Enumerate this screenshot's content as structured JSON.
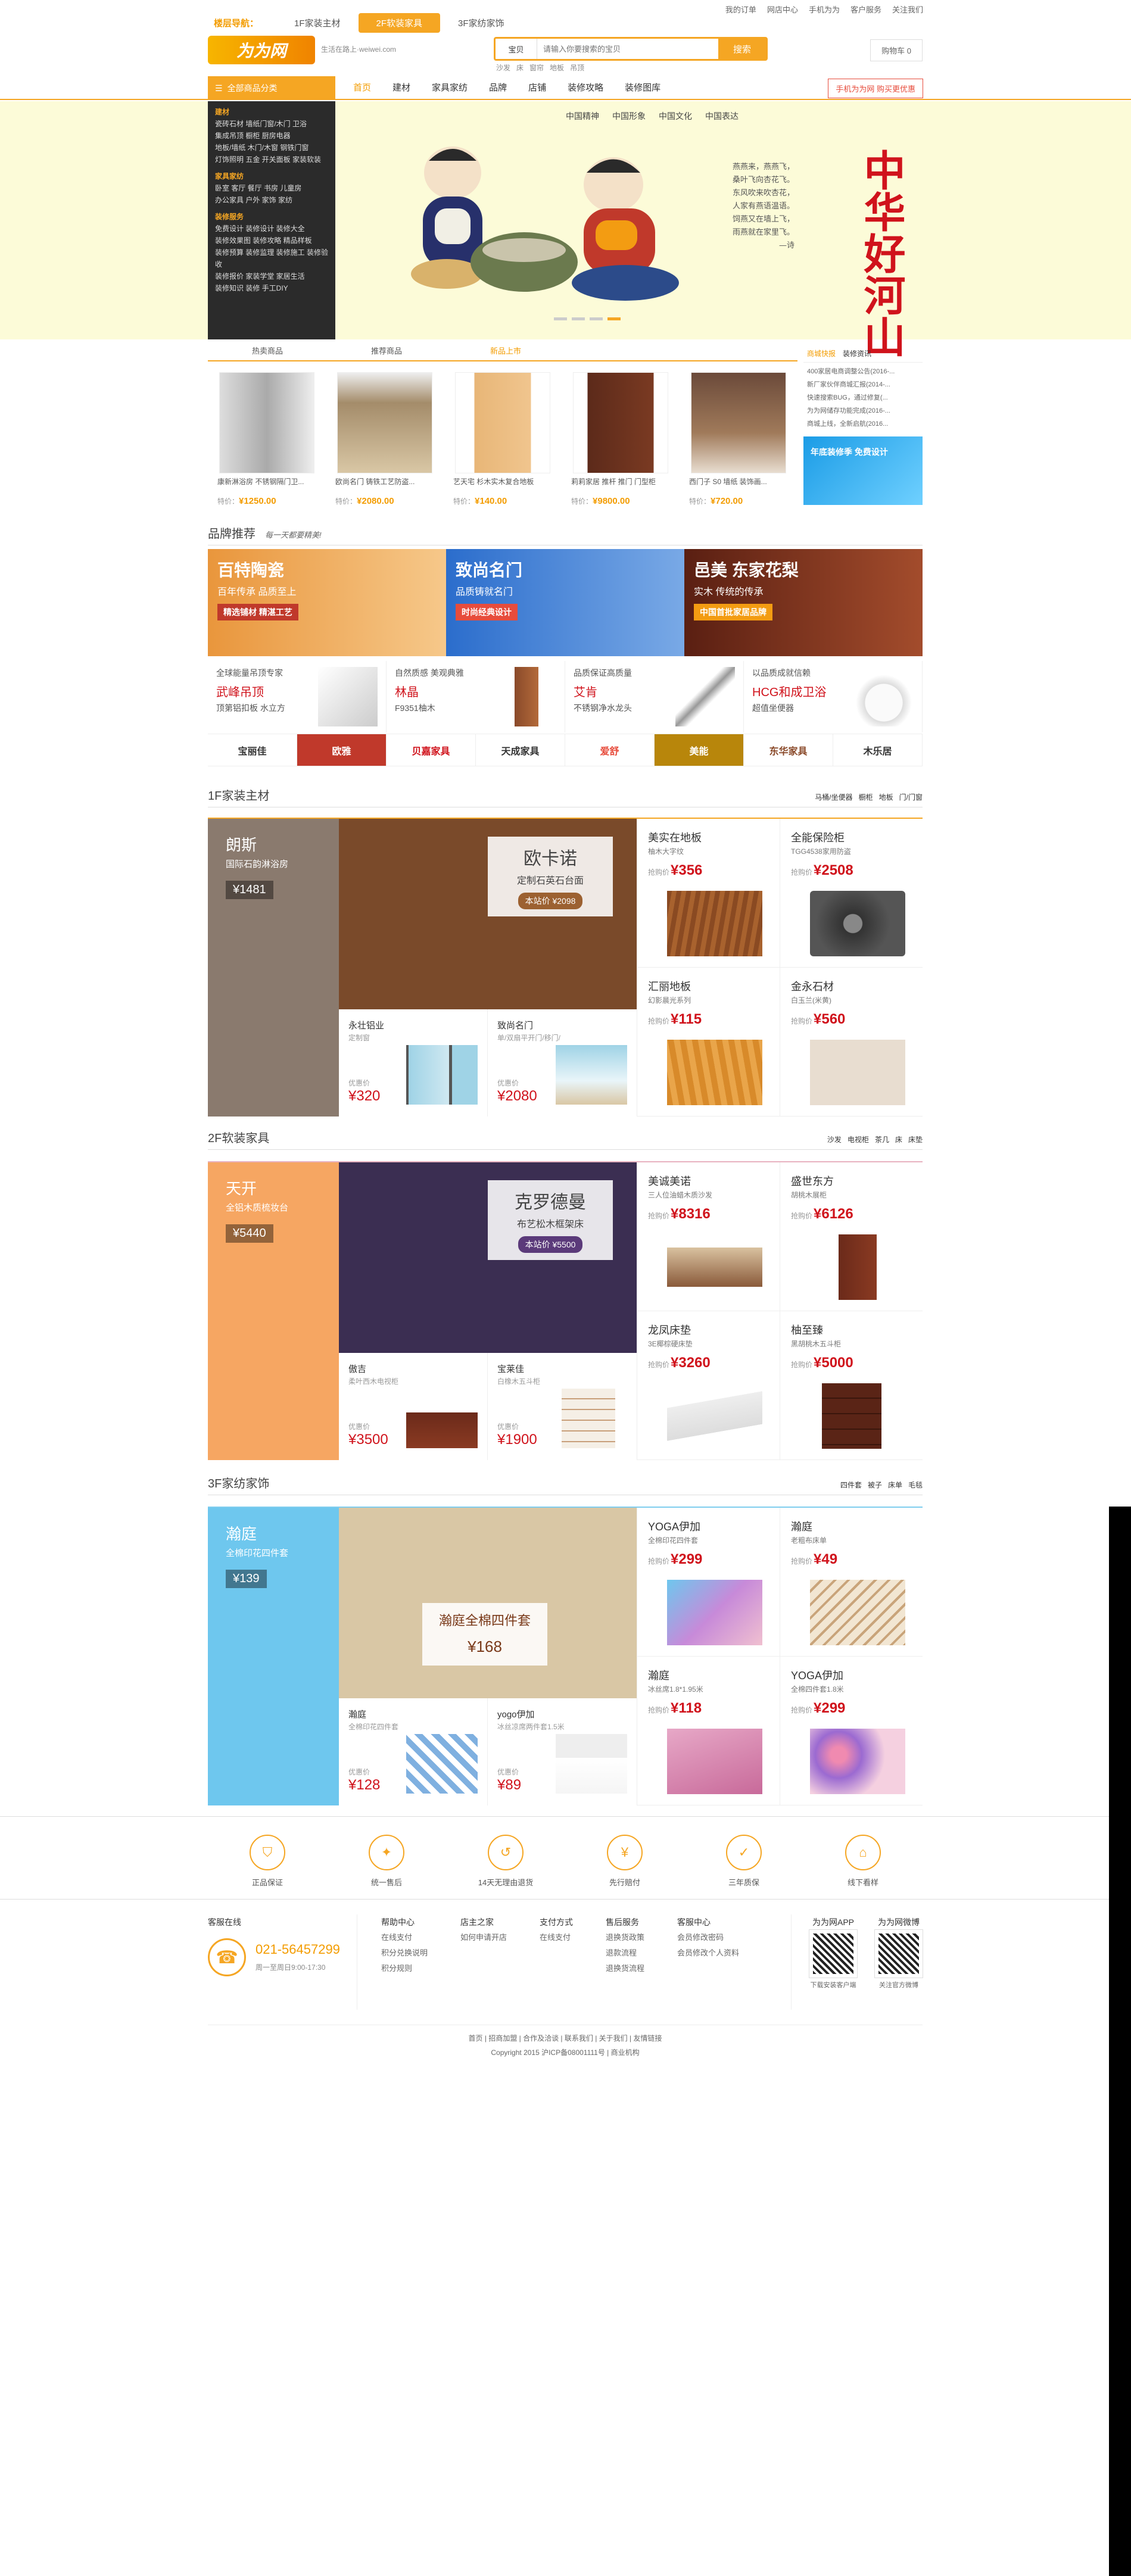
{
  "topbar": {
    "floors": [
      "楼层导航：",
      "1F家装主材",
      "2F软装家具",
      "3F家纺家饰"
    ],
    "links": [
      "我的订单",
      "网店中心",
      "手机为为",
      "客户服务",
      "关注我们"
    ]
  },
  "header": {
    "logo": "为为网",
    "slogan": "生活在路上·weiwei.com",
    "search_select": "宝贝",
    "search_placeholder": "请输入你要搜索的宝贝",
    "search_button": "搜索",
    "hotwords": [
      "沙发",
      "床",
      "窗帘",
      "地板",
      "吊顶"
    ],
    "cart": "购物车 0"
  },
  "nav": {
    "category_button": "全部商品分类",
    "links": [
      "首页",
      "建材",
      "家具家纺",
      "品牌",
      "店铺",
      "装修攻略",
      "装修图库"
    ],
    "app_button": "手机为为网 购买更优惠"
  },
  "category_panel": [
    {
      "title": "建材",
      "lines": [
        "瓷砖石材 墙纸门窗/木门 卫浴",
        "集成吊顶 橱柜 厨房电器",
        "地板/墙纸 木门/木窗 钢铁门窗",
        "灯饰照明 五金 开关面板 家装软装"
      ]
    },
    {
      "title": "家具家纺",
      "lines": [
        "卧室 客厅 餐厅 书房 儿童房",
        "办公家具 户外 家饰 家纺"
      ]
    },
    {
      "title": "装修服务",
      "lines": [
        "免费设计 装修设计 装修大全",
        "装修效果图 装修攻略 精品样板",
        "装修预算 装修监理 装修施工 装修验收",
        "装修报价 家装学堂 家居生活",
        "装修知识 装修 手工DIY"
      ]
    }
  ],
  "banner": {
    "tags": [
      "中国精神",
      "中国形象",
      "中国文化",
      "中国表达"
    ],
    "poem": [
      "燕燕来，燕燕飞，",
      "桑叶飞向杏花飞。",
      "东风吹来吹杏花，",
      "人家有燕语温语。",
      "饲燕又在墙上飞，",
      "雨燕就在家里飞。"
    ],
    "poem_sign": "—诗",
    "callig": "中华好河山"
  },
  "product_tabs": [
    "热卖商品",
    "推荐商品",
    "新品上市"
  ],
  "products": [
    {
      "title": "康新淋浴房 不锈钢隔门卫...",
      "price_label": "特价：",
      "price": "¥1250.00"
    },
    {
      "title": "欧尚名门 铸铁工艺防盗...",
      "price_label": "特价：",
      "price": "¥2080.00"
    },
    {
      "title": "艺天宅 杉木实木复合地板",
      "price_label": "特价：",
      "price": "¥140.00"
    },
    {
      "title": "莉莉家居 推杆 推门 门型柜",
      "price_label": "特价：",
      "price": "¥9800.00"
    },
    {
      "title": "西门子 S0 墙纸 装饰画...",
      "price_label": "特价：",
      "price": "¥720.00"
    }
  ],
  "news": {
    "tabs": [
      "商城快报",
      "装修资讯"
    ],
    "items": [
      "400家居电商调整公告(2016-...",
      "新厂家伙伴商城汇报(2014-...",
      "快速搜索BUG，通过修复(...",
      "为为网储存功能完成(2016-...",
      "商城上线，全新启航(2016..."
    ],
    "ad": "年底装修季 免费设计"
  },
  "brand_section": {
    "title": "品牌推荐",
    "sub": "每一天都要精美!"
  },
  "brand_banners": [
    {
      "t": "百特陶瓷",
      "s": "百年传承 品质至上",
      "tag": "精选铺材 精湛工艺",
      "bg": "linear-gradient(90deg,#e9963c,#f6c88a)"
    },
    {
      "t": "致尚名门",
      "s": "品质铸就名门",
      "tag": "时尚经典设计",
      "bg": "linear-gradient(90deg,#2b6dcc,#79a9e6)"
    },
    {
      "t": "邑美 东家花梨",
      "s": "实木 传统的传承",
      "tag": "中国首批家居品牌",
      "bg": "linear-gradient(90deg,#5a1f12,#a34c2c)"
    }
  ],
  "brand_cells": [
    {
      "c1": "全球能量吊顶专家",
      "c2": "武峰吊顶",
      "c3": "顶第铝扣板 水立方"
    },
    {
      "c1": "自然质感 美观典雅",
      "c2": "林晶",
      "c3": "F9351柚木"
    },
    {
      "c1": "品质保证高质量",
      "c2": "艾肯",
      "c3": "不锈钢净水龙头"
    },
    {
      "c1": "以品质成就信赖",
      "c2": "HCG和成卫浴",
      "c3": "超值坐便器"
    }
  ],
  "brand_logos": [
    "宝丽佳",
    "欧雅",
    "贝嘉家具",
    "天成家具",
    "爱舒",
    "美能",
    "东华家具",
    "木乐居"
  ],
  "floor1": {
    "title": "1F家装主材",
    "links": [
      "马桶/坐便器",
      "橱柜",
      "地板",
      "门/门窗"
    ],
    "left": {
      "a": "朗斯",
      "b": "国际石韵淋浴房",
      "c": "¥1481",
      "bg": "#8a7a6e"
    },
    "mid": {
      "m1": "欧卡诺",
      "m2": "定制石英石台面",
      "m3": "本站价 ¥2098",
      "bg": "#7a4a2a"
    },
    "bl": {
      "n": "永壮铝业",
      "s": "定制窗",
      "pl": "¥320",
      "pll": "优惠价"
    },
    "br": {
      "n": "致尚名门",
      "s": "单/双扇平开门/移门/",
      "pl": "¥2080",
      "pll": "优惠价"
    },
    "cells": [
      {
        "n": "美实在地板",
        "d": "柚木大字纹",
        "p": "¥356"
      },
      {
        "n": "全能保险柜",
        "d": "TGG4538家用防盗",
        "p": "¥2508"
      },
      {
        "n": "汇丽地板",
        "d": "幻影晨光系列",
        "p": "¥115"
      },
      {
        "n": "金永石材",
        "d": "白玉兰(米黄)",
        "p": "¥560"
      }
    ]
  },
  "floor2": {
    "title": "2F软装家具",
    "links": [
      "沙发",
      "电视柜",
      "茶几",
      "床",
      "床垫"
    ],
    "left": {
      "a": "天开",
      "b": "全铝木质梳妆台",
      "c": "¥5440",
      "bg": "#f6a662"
    },
    "mid": {
      "m1": "克罗德曼",
      "m2": "布艺松木框架床",
      "m3": "本站价 ¥5500",
      "bg": "#3b2e52"
    },
    "bl": {
      "n": "傲吉",
      "s": "柔叶西木电视柜",
      "pl": "¥3500",
      "pll": "优惠价"
    },
    "br": {
      "n": "宝莱佳",
      "s": "白橡木五斗柜",
      "pl": "¥1900",
      "pll": "优惠价"
    },
    "cells": [
      {
        "n": "美诚美诺",
        "d": "三人位油蜡木质沙发",
        "p": "¥8316"
      },
      {
        "n": "盛世东方",
        "d": "胡桃木展柜",
        "p": "¥6126"
      },
      {
        "n": "龙凤床垫",
        "d": "3E椰棕硬床垫",
        "p": "¥3260"
      },
      {
        "n": "柚至臻",
        "d": "黑胡桃木五斗柜",
        "p": "¥5000"
      }
    ]
  },
  "floor3": {
    "title": "3F家纺家饰",
    "links": [
      "四件套",
      "被子",
      "床单",
      "毛毯"
    ],
    "left": {
      "a": "瀚庭",
      "b": "全棉印花四件套",
      "c": "¥139",
      "bg": "#6ec7ee"
    },
    "mid": {
      "m1": "瀚庭全棉四件套",
      "m2": "",
      "m3": "¥168",
      "bg": "#d9c7a5"
    },
    "bl": {
      "n": "瀚庭",
      "s": "全棉印花四件套",
      "pl": "¥128",
      "pll": "优惠价"
    },
    "br": {
      "n": "yogo伊加",
      "s": "冰丝凉席两件套1.5米",
      "pl": "¥89",
      "pll": "优惠价"
    },
    "cells": [
      {
        "n": "YOGA伊加",
        "d": "全棉印花四件套",
        "p": "¥299"
      },
      {
        "n": "瀚庭",
        "d": "老粗布床单",
        "p": "¥49"
      },
      {
        "n": "瀚庭",
        "d": "冰丝席1.8*1.95米",
        "p": "¥118"
      },
      {
        "n": "YOGA伊加",
        "d": "全棉四件套1.8米",
        "p": "¥299"
      }
    ]
  },
  "services": [
    "正品保证",
    "统一售后",
    "14天无理由退货",
    "先行赔付",
    "三年质保",
    "线下看样"
  ],
  "footer": {
    "hotline_title": "客服在线",
    "hotline": "021-56457299",
    "hours": "周一至周日9:00-17:30",
    "cols": [
      {
        "h": "帮助中心",
        "items": [
          "在线支付",
          "积分兑换说明",
          "积分规则"
        ]
      },
      {
        "h": "店主之家",
        "items": [
          "如何申请开店"
        ]
      },
      {
        "h": "支付方式",
        "items": [
          "在线支付"
        ]
      },
      {
        "h": "售后服务",
        "items": [
          "退换货政策",
          "退款流程",
          "退换货流程"
        ]
      },
      {
        "h": "客服中心",
        "items": [
          "会员修改密码",
          "会员修改个人资料"
        ]
      }
    ],
    "qr": [
      {
        "h": "为为网APP",
        "cap": "下载安装客户端"
      },
      {
        "h": "为为网微博",
        "cap": "关注官方微博"
      }
    ]
  },
  "copyright": {
    "links": "首页 | 招商加盟 | 合作及洽谈 | 联系我们 | 关于我们 | 友情链接",
    "text": "Copyright 2015 沪ICP备08001111号 | 商业机构"
  }
}
